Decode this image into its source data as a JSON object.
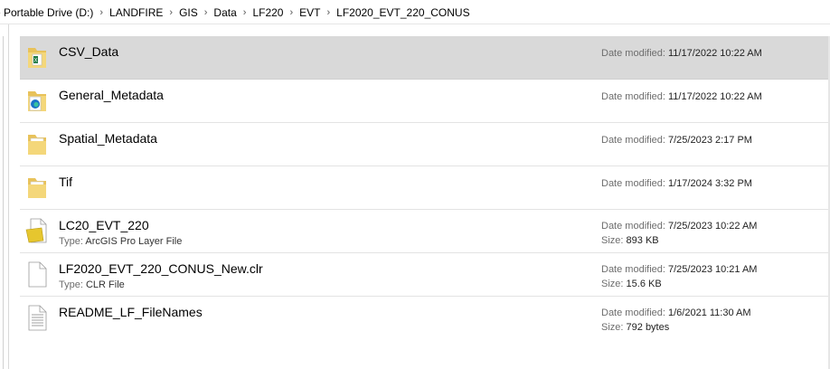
{
  "breadcrumb": {
    "items": [
      "e Portable Drive (D:)",
      "LANDFIRE",
      "GIS",
      "Data",
      "LF220",
      "EVT",
      "LF2020_EVT_220_CONUS"
    ],
    "separator": "›"
  },
  "labels": {
    "date_modified": "Date modified:",
    "size": "Size:",
    "type": "Type:"
  },
  "files": [
    {
      "name": "CSV_Data",
      "kind": "folder-excel",
      "date": "11/17/2022 10:22 AM",
      "selected": true
    },
    {
      "name": "General_Metadata",
      "kind": "folder-edge",
      "date": "11/17/2022 10:22 AM"
    },
    {
      "name": "Spatial_Metadata",
      "kind": "folder",
      "date": "7/25/2023 2:17 PM"
    },
    {
      "name": "Tif",
      "kind": "folder",
      "date": "1/17/2024 3:32 PM"
    },
    {
      "name": "LC20_EVT_220",
      "kind": "layer-file",
      "type": "ArcGIS Pro Layer File",
      "date": "7/25/2023 10:22 AM",
      "size": "893 KB"
    },
    {
      "name": "LF2020_EVT_220_CONUS_New.clr",
      "kind": "blank-file",
      "type": "CLR File",
      "date": "7/25/2023 10:21 AM",
      "size": "15.6 KB"
    },
    {
      "name": "README_LF_FileNames",
      "kind": "text-file",
      "date": "1/6/2021 11:30 AM",
      "size": "792 bytes"
    }
  ]
}
